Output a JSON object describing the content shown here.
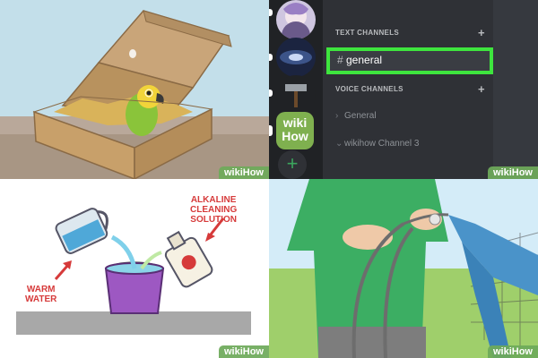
{
  "watermark": {
    "wiki": "wiki",
    "how": "How"
  },
  "discord": {
    "text_channels_label": "TEXT CHANNELS",
    "voice_channels_label": "VOICE CHANNELS",
    "selected_channel": {
      "hash": "#",
      "name": "general"
    },
    "voice_channels": [
      "General",
      "wikihow Channel 3"
    ],
    "server_icon_text": [
      "wiki",
      "How"
    ],
    "add_server": "+",
    "plus": "+",
    "highlight_color": "#3ee53e"
  },
  "cleaning": {
    "label_right": [
      "ALKALINE",
      "CLEANING",
      "SOLUTION"
    ],
    "label_left": [
      "WARM",
      "WATER"
    ]
  }
}
